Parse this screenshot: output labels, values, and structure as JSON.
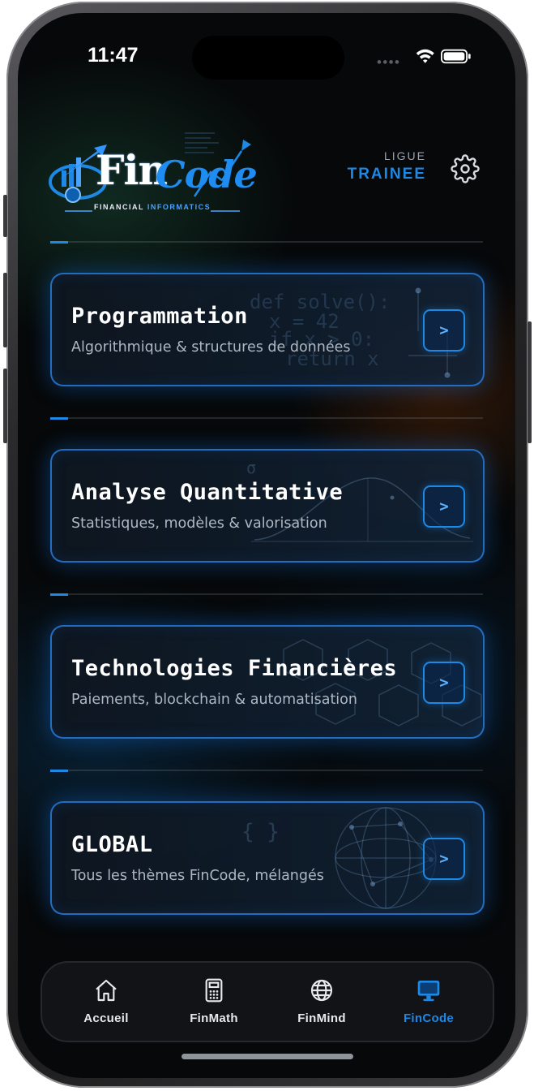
{
  "status_bar": {
    "time": "11:47"
  },
  "header": {
    "logo": {
      "word_fin": "Fin",
      "word_code": "Code",
      "tagline_part1": "FINANCIAL ",
      "tagline_part2": "INFORMATICS"
    },
    "league_label": "LIGUE",
    "league_value": "TRAINEE"
  },
  "cards": [
    {
      "title": "Programmation",
      "subtitle": "Algorithmique & structures de données",
      "arrow": ">"
    },
    {
      "title": "Analyse Quantitative",
      "subtitle": "Statistiques, modèles & valorisation",
      "arrow": ">"
    },
    {
      "title": "Technologies Financières",
      "subtitle": "Paiements, blockchain & automatisation",
      "arrow": ">"
    },
    {
      "title": "GLOBAL",
      "subtitle": "Tous les thèmes FinCode, mélangés",
      "arrow": ">"
    }
  ],
  "card_decorations": {
    "code_lines": [
      "def solve():",
      "x = 42",
      "if x > 0:",
      "return x"
    ],
    "sigma": "σ",
    "braces": "{ }"
  },
  "tabbar": {
    "items": [
      {
        "label": "Accueil",
        "icon": "home-icon",
        "active": false
      },
      {
        "label": "FinMath",
        "icon": "calculator-icon",
        "active": false
      },
      {
        "label": "FinMind",
        "icon": "globe-icon",
        "active": false
      },
      {
        "label": "FinCode",
        "icon": "monitor-icon",
        "active": true
      }
    ]
  },
  "colors": {
    "accent": "#1e88e5",
    "background": "#060809",
    "card_border": "#2882e6"
  }
}
